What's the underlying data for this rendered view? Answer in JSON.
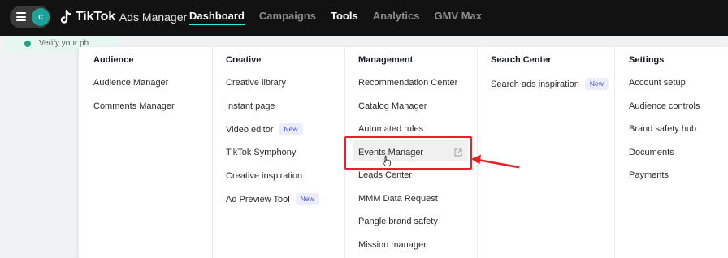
{
  "topbar": {
    "avatar_initial": "c",
    "brand": "TikTok",
    "product": "Ads Manager",
    "nav": [
      "Dashboard",
      "Campaigns",
      "Tools",
      "Analytics",
      "GMV Max"
    ]
  },
  "notice": {
    "text": "Verify your ph"
  },
  "dropdown": {
    "audience": {
      "heading": "Audience",
      "items": [
        "Audience Manager",
        "Comments Manager"
      ]
    },
    "creative": {
      "heading": "Creative",
      "items": [
        "Creative library",
        "Instant page",
        "Video editor",
        "TikTok Symphony",
        "Creative inspiration",
        "Ad Preview Tool"
      ],
      "badge": "New"
    },
    "management": {
      "heading": "Management",
      "items": [
        "Recommendation Center",
        "Catalog Manager",
        "Automated rules",
        "Events Manager",
        "Leads Center",
        "MMM Data Request",
        "Pangle brand safety",
        "Mission manager"
      ]
    },
    "search_center": {
      "heading": "Search Center",
      "items": [
        "Search ads inspiration"
      ],
      "badge": "New"
    },
    "settings": {
      "heading": "Settings",
      "items": [
        "Account setup",
        "Audience controls",
        "Brand safety hub",
        "Documents",
        "Payments"
      ]
    }
  },
  "annotation": {
    "highlight_color": "#e8202a"
  },
  "icons": {
    "menu": "hamburger-icon",
    "external": "external-link-icon",
    "cursor": "hand-cursor-icon",
    "info": "info-icon"
  }
}
